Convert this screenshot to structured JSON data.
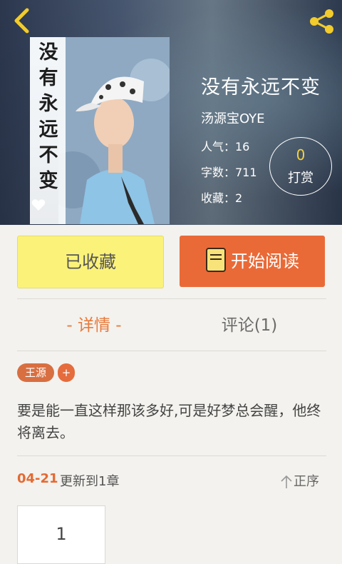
{
  "header": {
    "back_icon": "chevron-left-icon",
    "share_icon": "share-icon",
    "icon_color": "#f2cb2c"
  },
  "cover": {
    "title_chars": [
      "没",
      "有",
      "永",
      "远",
      "不",
      "变"
    ],
    "heart_icon": "heart-icon"
  },
  "book": {
    "title": "没有永远不变",
    "author": "汤源宝OYE",
    "popularity": "人气：16",
    "word_count": "字数：711",
    "favorites": "收藏：2"
  },
  "tip": {
    "count": "0",
    "label": "打赏"
  },
  "actions": {
    "favorite_label": "已收藏",
    "read_label": "开始阅读",
    "favorite_color": "#fbf27a",
    "read_color": "#ea6a37"
  },
  "tabs": {
    "details": "- 详情 -",
    "comments": "评论(1)",
    "accent": "#e87a3c"
  },
  "tags": {
    "items": [
      "王源"
    ],
    "add_label": "+"
  },
  "description": "要是能一直这样那该多好,可是好梦总会醒，他终将离去。",
  "updates": {
    "date": "04-21",
    "text": "更新到1章",
    "order_label": "正序"
  },
  "chapters": [
    "1"
  ]
}
